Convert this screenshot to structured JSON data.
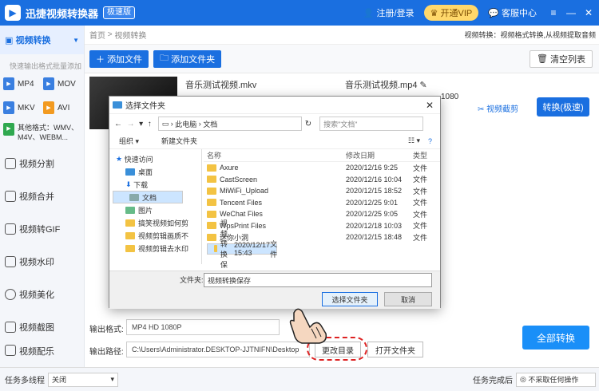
{
  "titlebar": {
    "app_title": "迅捷视频转换器",
    "badge": "极速版",
    "login": "注册/登录",
    "vip": "开通VIP",
    "feedback": "客服中心"
  },
  "sidebar": {
    "active": "视频转换",
    "hint": "快速输出格式批量添加",
    "formats": [
      "MP4",
      "MOV",
      "MKV",
      "AVI"
    ],
    "other_formats": "其他格式：WMV、M4V、WEBM...",
    "items": [
      "视频分割",
      "视频合并",
      "视频转GIF",
      "视频水印",
      "视频美化",
      "视频截图",
      "视频配乐"
    ]
  },
  "main": {
    "breadcrumb_home": "首页",
    "breadcrumb_current": "视频转换",
    "tip": "视频转换：视频格式转换,从视频提取音频",
    "add_file": "添加文件",
    "add_folder": "添加文件夹",
    "clear_list": "清空列表",
    "file": {
      "name": "音乐测试视频.mkv",
      "output": "音乐测试视频.mp4",
      "resolution": "1080",
      "cut": "视频截剪",
      "convert": "转换(极速)"
    },
    "output_format_label": "输出格式:",
    "output_format_value": "MP4  HD 1080P",
    "output_path_label": "输出路径:",
    "output_path_value": "C:\\Users\\Administrator.DESKTOP-JJTNIFN\\Desktop",
    "change_dir": "更改目录",
    "open_dir": "打开文件夹",
    "all_convert": "全部转换"
  },
  "status": {
    "multi_thread_label": "任务多线程",
    "multi_thread_value": "关闭",
    "done_label": "任务完成后",
    "done_value": "不采取任何操作"
  },
  "dialog": {
    "title": "选择文件夹",
    "path": [
      "此电脑",
      "文档"
    ],
    "search_placeholder": "搜索\"文档\"",
    "organize": "组织",
    "new_folder": "新建文件夹",
    "tree": [
      {
        "label": "快速访问",
        "sub": false
      },
      {
        "label": "桌面",
        "sub": true
      },
      {
        "label": "下载",
        "sub": true
      },
      {
        "label": "文档",
        "sub": true,
        "selected": true
      },
      {
        "label": "图片",
        "sub": true
      },
      {
        "label": "搞笑视频如何剪",
        "sub": true
      },
      {
        "label": "视频剪辑画质不",
        "sub": true
      },
      {
        "label": "视频剪辑去水印",
        "sub": true
      }
    ],
    "headers": {
      "name": "名称",
      "date": "修改日期",
      "type": "类型"
    },
    "rows": [
      {
        "name": "Axure",
        "date": "2020/12/16 9:25",
        "type": "文件"
      },
      {
        "name": "CastScreen",
        "date": "2020/12/16 10:04",
        "type": "文件"
      },
      {
        "name": "MiWiFi_Upload",
        "date": "2020/12/15 18:52",
        "type": "文件"
      },
      {
        "name": "Tencent Files",
        "date": "2020/12/25 9:01",
        "type": "文件"
      },
      {
        "name": "WeChat Files",
        "date": "2020/12/25 9:05",
        "type": "文件"
      },
      {
        "name": "WpsPrint Files",
        "date": "2020/12/18 10:03",
        "type": "文件"
      },
      {
        "name": "迷你小洞",
        "date": "2020/12/15 18:48",
        "type": "文件"
      },
      {
        "name": "视频转换保存",
        "date": "2020/12/17 15:43",
        "type": "文件",
        "selected": true
      }
    ],
    "folder_label": "文件夹:",
    "folder_value": "视频转换保存",
    "ok": "选择文件夹",
    "cancel": "取消"
  }
}
